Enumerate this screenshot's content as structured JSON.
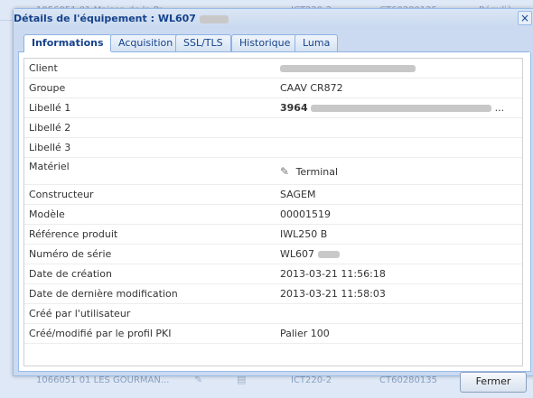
{
  "window": {
    "title": "Détails de l'équipement : WL607",
    "close_glyph": "×"
  },
  "tabs": [
    {
      "label": "Informations",
      "active": true
    },
    {
      "label": "Acquisition",
      "active": false
    },
    {
      "label": "SSL/TLS",
      "active": false
    },
    {
      "label": "Historique",
      "active": false
    },
    {
      "label": "Luma",
      "active": false
    }
  ],
  "fields": {
    "client": {
      "label": "Client",
      "value": ""
    },
    "groupe": {
      "label": "Groupe",
      "value": "CAAV CR872"
    },
    "libelle1": {
      "label": "Libellé 1",
      "value": "3964",
      "suffix": "..."
    },
    "libelle2": {
      "label": "Libellé 2",
      "value": ""
    },
    "libelle3": {
      "label": "Libellé 3",
      "value": ""
    },
    "materiel": {
      "label": "Matériel",
      "value": "Terminal",
      "icon": "pencil-icon"
    },
    "constructeur": {
      "label": "Constructeur",
      "value": "SAGEM"
    },
    "modele": {
      "label": "Modèle",
      "value": "00001519"
    },
    "reference": {
      "label": "Référence produit",
      "value": "IWL250 B"
    },
    "serie": {
      "label": "Numéro de série",
      "value": "WL607"
    },
    "creation": {
      "label": "Date de création",
      "value": "2013-03-21 11:56:18"
    },
    "modification": {
      "label": "Date de dernière modification",
      "value": "2013-03-21 11:58:03"
    },
    "cree_par": {
      "label": "Créé par l'utilisateur",
      "value": ""
    },
    "profil_pki": {
      "label": "Créé/modifié par le profil PKI",
      "value": "Palier 100"
    }
  },
  "footer": {
    "fermer_label": "Fermer"
  },
  "background": {
    "top_row": [
      "1056051 01 Maison de la Pr...",
      "ICT220-2",
      "CT60280125",
      "Réguliè"
    ],
    "row_a": [
      "",
      "",
      "",
      ""
    ],
    "row_b": [
      "1066051 01 LES GOURMAN...",
      "ICT220-2",
      "CT60280135"
    ]
  }
}
